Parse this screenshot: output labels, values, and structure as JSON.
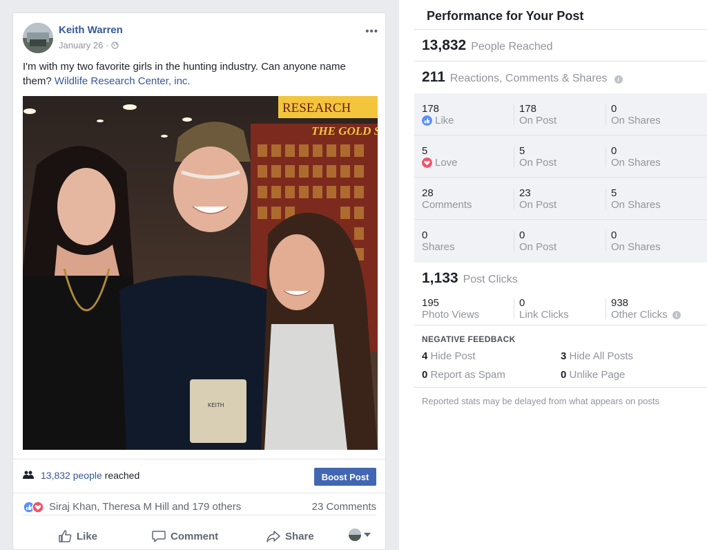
{
  "post": {
    "author": "Keith Warren",
    "date": "January 26 · ",
    "text_main": "I'm with my two favorite girls in the hunting industry. Can anyone name them? ",
    "mention": "Wildlife Research Center, inc.",
    "photo_signs": [
      "RESEARCH",
      "THE GOLD STA"
    ],
    "badge_name": "KEITH",
    "reach_count": "13,832 people",
    "reach_suffix": " reached",
    "boost_label": "Boost Post",
    "reactors": "Siraj Khan, Theresa M Hill and 179 others",
    "comments": "23 Comments",
    "actions": {
      "like": "Like",
      "comment": "Comment",
      "share": "Share"
    },
    "colors": {
      "link": "#365899",
      "button": "#4267b2"
    }
  },
  "performance": {
    "title": "Performance for Your Post",
    "reached": {
      "value": "13,832",
      "label": "People Reached"
    },
    "engagement": {
      "value": "211",
      "label": "Reactions, Comments & Shares"
    },
    "breakdown": [
      {
        "total": "178",
        "type": "Like",
        "icon": "like-icon",
        "on_post": "178",
        "on_shares": "0"
      },
      {
        "total": "5",
        "type": "Love",
        "icon": "love-icon",
        "on_post": "5",
        "on_shares": "0"
      },
      {
        "total": "28",
        "type": "Comments",
        "on_post": "23",
        "on_shares": "5"
      },
      {
        "total": "0",
        "type": "Shares",
        "on_post": "0",
        "on_shares": "0"
      }
    ],
    "on_post_label": "On Post",
    "on_shares_label": "On Shares",
    "clicks": {
      "value": "1,133",
      "label": "Post Clicks"
    },
    "click_breakdown": [
      {
        "value": "195",
        "label": "Photo Views"
      },
      {
        "value": "0",
        "label": "Link Clicks"
      },
      {
        "value": "938",
        "label": "Other Clicks"
      }
    ],
    "negative": {
      "title": "NEGATIVE FEEDBACK",
      "items": [
        {
          "value": "4",
          "label": "Hide Post"
        },
        {
          "value": "3",
          "label": "Hide All Posts"
        },
        {
          "value": "0",
          "label": "Report as Spam"
        },
        {
          "value": "0",
          "label": "Unlike Page"
        }
      ]
    },
    "footnote": "Reported stats may be delayed from what appears on posts"
  }
}
